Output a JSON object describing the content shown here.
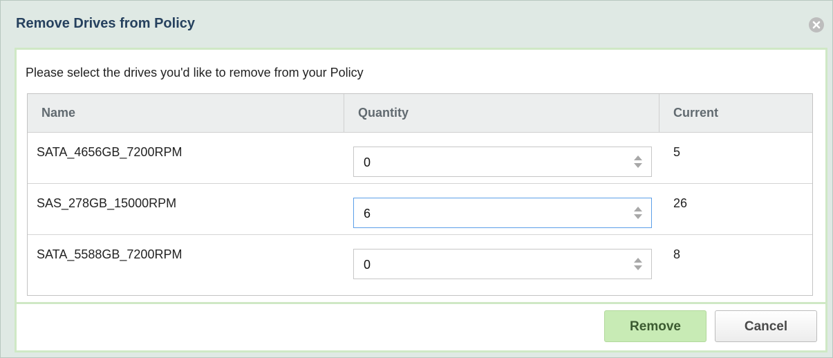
{
  "dialog": {
    "title": "Remove Drives from Policy",
    "close_icon": "close-circle-icon",
    "instructions": "Please select the drives you'd like to remove from your Policy"
  },
  "table": {
    "columns": [
      "Name",
      "Quantity",
      "Current"
    ],
    "rows": [
      {
        "name": "SATA_4656GB_7200RPM",
        "quantity": "0",
        "current": "5",
        "focused": false
      },
      {
        "name": "SAS_278GB_15000RPM",
        "quantity": "6",
        "current": "26",
        "focused": true
      },
      {
        "name": "SATA_5588GB_7200RPM",
        "quantity": "0",
        "current": "8",
        "focused": false
      }
    ],
    "spinner_icon": "spinner-arrows-icon"
  },
  "footer": {
    "remove_label": "Remove",
    "cancel_label": "Cancel"
  },
  "colors": {
    "title_text": "#26415e",
    "accent_border": "#cfe8c5",
    "primary_button": "#c8ebb5",
    "focus_border": "#5b9ee8"
  }
}
